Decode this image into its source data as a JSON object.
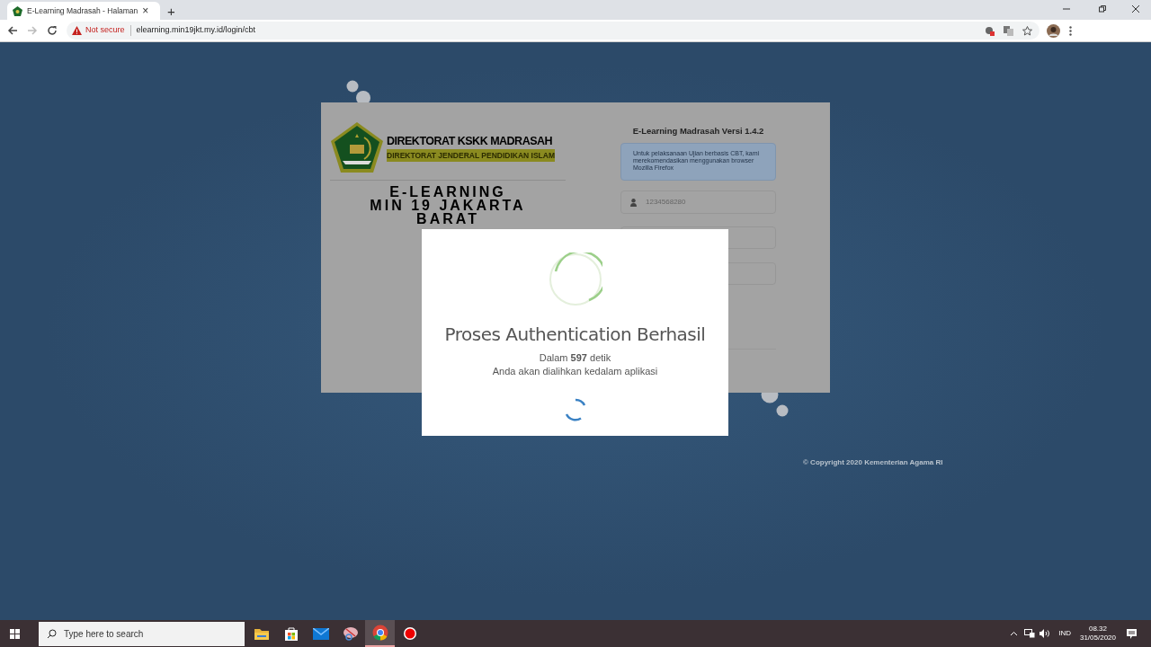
{
  "browser": {
    "tab": {
      "title": "E-Learning Madrasah - Halaman",
      "close": "×"
    },
    "new_tab": "+",
    "nav": {
      "back_enabled": true,
      "forward_enabled": false
    },
    "security": "Not secure",
    "url": "elearning.min19jkt.my.id/login/cbt"
  },
  "page": {
    "header": {
      "line_1": "DIREKTORAT KSKK MADRASAH",
      "line_2": "DIREKTORAT JENDERAL PENDIDIKAN ISLAM"
    },
    "app_title": [
      "E-LEARNING",
      "MIN 19 JAKARTA",
      "BARAT"
    ],
    "version": "E-Learning Madrasah Versi 1.4.2",
    "notice": "Untuk pelaksanaan Ujian berbasis CBT, kami merekomendasikan menggunakan browser Mozilla Firefox",
    "username": "1234568280",
    "copyright": "© Copyright 2020 Kementerian Agama RI"
  },
  "modal": {
    "title": "Proses Authentication Berhasil",
    "countdown": "Dalam **597** detik",
    "message": "Anda akan dialihkan kedalam aplikasi"
  },
  "taskbar": {
    "search_placeholder": "Type here to search",
    "apps": [
      {
        "kind": "folder",
        "selected": false
      },
      {
        "kind": "store",
        "selected": false
      },
      {
        "kind": "mail",
        "selected": false
      },
      {
        "kind": "snip",
        "selected": false
      },
      {
        "kind": "browser",
        "selected": true
      },
      {
        "kind": "record",
        "selected": false
      }
    ],
    "language": "IND",
    "time": "08.32",
    "date": "31/05/2020"
  }
}
